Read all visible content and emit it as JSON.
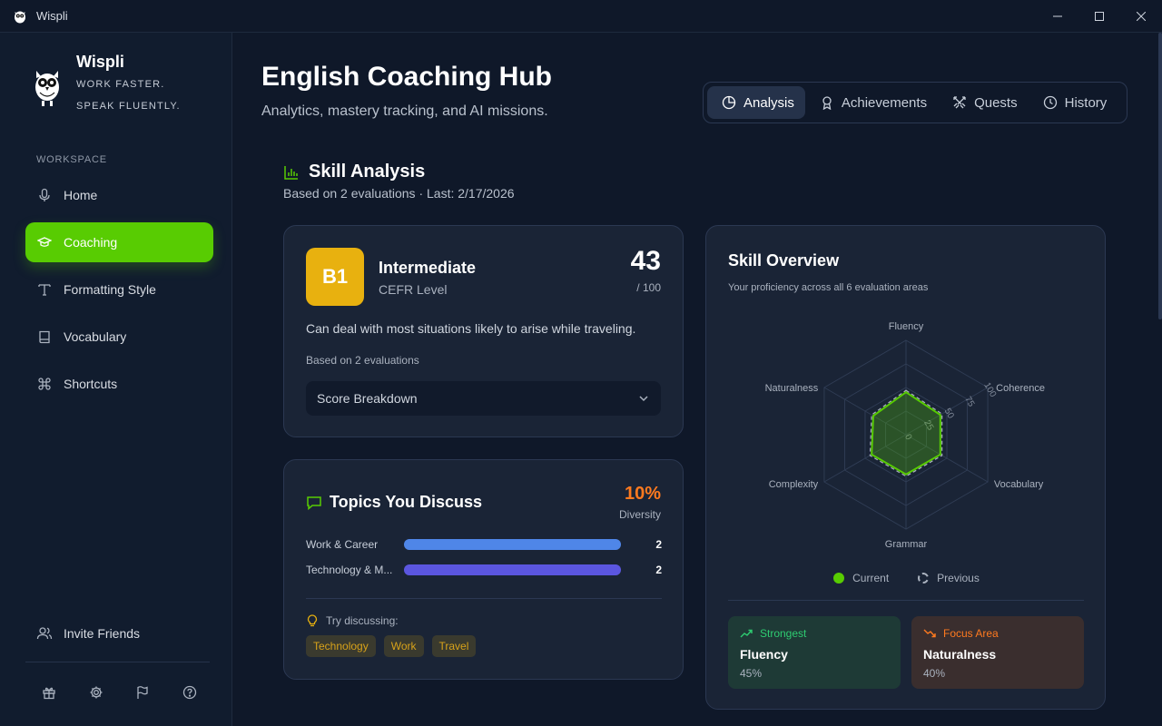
{
  "window": {
    "title": "Wispli",
    "controls": [
      "minimize",
      "maximize",
      "close"
    ]
  },
  "sidebar": {
    "brand_name": "Wispli",
    "tagline_1": "WORK FASTER.",
    "tagline_2": "SPEAK FLUENTLY.",
    "section_label": "WORKSPACE",
    "items": [
      {
        "label": "Home",
        "icon": "mic-icon",
        "active": false
      },
      {
        "label": "Coaching",
        "icon": "graduation-cap-icon",
        "active": true
      },
      {
        "label": "Formatting Style",
        "icon": "text-type-icon",
        "active": false
      },
      {
        "label": "Vocabulary",
        "icon": "book-icon",
        "active": false
      },
      {
        "label": "Shortcuts",
        "icon": "command-icon",
        "active": false
      }
    ],
    "invite_label": "Invite Friends",
    "bottom_icons": [
      "gift-icon",
      "gear-icon",
      "flag-icon",
      "help-icon"
    ]
  },
  "header": {
    "title": "English Coaching Hub",
    "subtitle": "Analytics, mastery tracking, and AI missions."
  },
  "tabs": [
    {
      "label": "Analysis",
      "icon": "pie-chart-icon",
      "active": true
    },
    {
      "label": "Achievements",
      "icon": "award-icon",
      "active": false
    },
    {
      "label": "Quests",
      "icon": "swords-icon",
      "active": false
    },
    {
      "label": "History",
      "icon": "clock-icon",
      "active": false
    }
  ],
  "analysis": {
    "title": "Skill Analysis",
    "subtitle": "Based on 2 evaluations · Last: 2/17/2026"
  },
  "cefr": {
    "badge": "B1",
    "level_name": "Intermediate",
    "level_type": "CEFR Level",
    "score": "43",
    "score_max": "/ 100",
    "description": "Can deal with most situations likely to arise while traveling.",
    "based_on": "Based on 2 evaluations",
    "breakdown_label": "Score Breakdown",
    "badge_color": "#e8b10f"
  },
  "topics": {
    "title": "Topics You Discuss",
    "diversity_value": "10%",
    "diversity_label": "Diversity",
    "items": [
      {
        "name": "Work & Career",
        "count": "2",
        "fraction": 1.0,
        "color": "#4f86e8"
      },
      {
        "name": "Technology & M...",
        "count": "2",
        "fraction": 1.0,
        "color": "#5b56e0"
      }
    ],
    "try_label": "Try discussing:",
    "suggestions": [
      "Technology",
      "Work",
      "Travel"
    ]
  },
  "overview": {
    "title": "Skill Overview",
    "subtitle": "Your proficiency across all 6 evaluation areas",
    "legend_current": "Current",
    "legend_previous": "Previous",
    "strongest_label": "Strongest",
    "strongest_skill": "Fluency",
    "strongest_value": "45%",
    "focus_label": "Focus Area",
    "focus_skill": "Naturalness",
    "focus_value": "40%"
  },
  "chart_data": {
    "type": "radar",
    "axes": [
      "Fluency",
      "Coherence",
      "Vocabulary",
      "Grammar",
      "Complexity",
      "Naturalness"
    ],
    "ticks": [
      "0",
      "25",
      "50",
      "75",
      "100"
    ],
    "range": [
      0,
      100
    ],
    "series": [
      {
        "name": "Current",
        "values": [
          45,
          42,
          42,
          42,
          42,
          40
        ],
        "color": "#58cc02"
      },
      {
        "name": "Previous",
        "values": [
          47,
          44,
          44,
          44,
          44,
          42
        ],
        "color": "#aab2bf"
      }
    ]
  }
}
